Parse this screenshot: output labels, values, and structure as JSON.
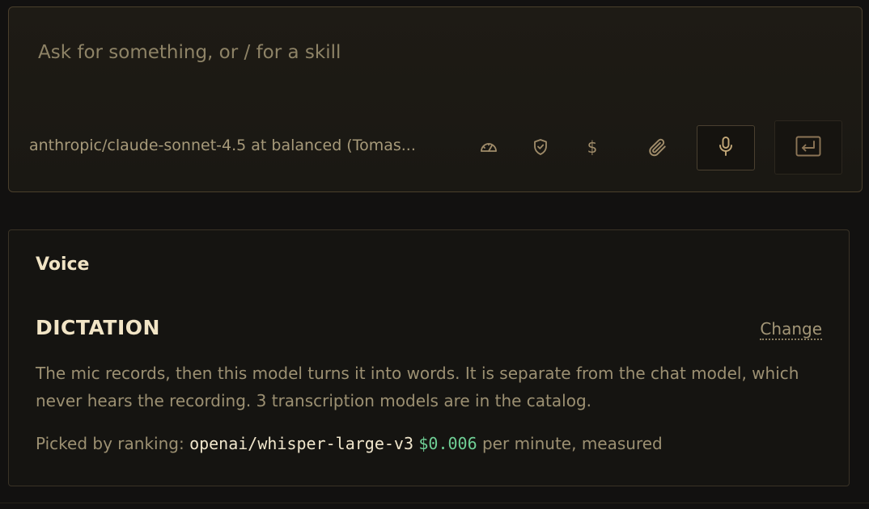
{
  "composer": {
    "placeholder": "Ask for something, or / for a skill",
    "model_label": "anthropic/claude-sonnet-4.5 at balanced (Tomas...",
    "toolbar_icons": [
      "gauge-icon",
      "shield-icon",
      "dollar-icon",
      "paperclip-icon",
      "microphone-icon",
      "enter-icon"
    ],
    "dollar_glyph": "$"
  },
  "voice": {
    "title": "Voice",
    "section_title": "DICTATION",
    "change_label": "Change",
    "description": "The mic records, then this model turns it into words. It is separate from the chat model, which never hears the recording. 3 transcription models are in the catalog.",
    "picked_prefix": "Picked by ranking:",
    "model": "openai/whisper-large-v3",
    "price": "$0.006",
    "price_suffix": "per minute, measured"
  },
  "colors": {
    "background": "#121110",
    "accent_gold": "#c3a878",
    "price_green": "#6fcf95",
    "text_primary": "#f0e3c4",
    "text_muted": "#9c9072"
  }
}
